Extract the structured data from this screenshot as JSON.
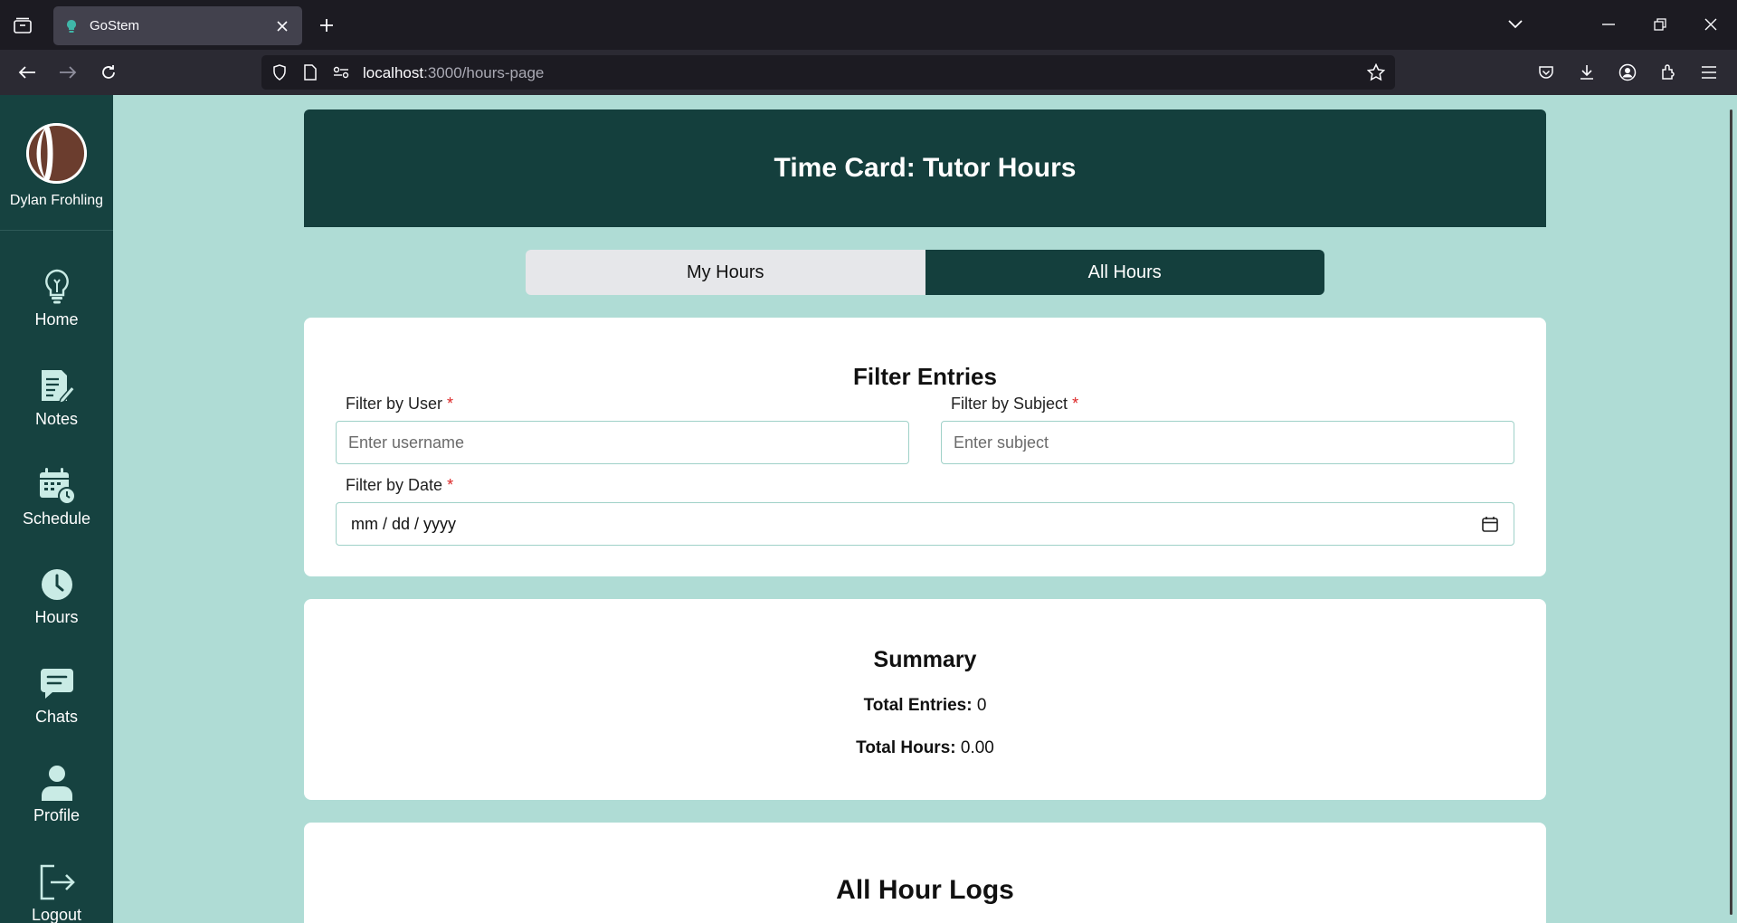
{
  "browser": {
    "tab_title": "GoStem",
    "url_host": "localhost",
    "url_path": ":3000/hours-page"
  },
  "sidebar": {
    "user_name": "Dylan Frohling",
    "items": [
      {
        "label": "Home",
        "icon": "lightbulb-icon"
      },
      {
        "label": "Notes",
        "icon": "notes-icon"
      },
      {
        "label": "Schedule",
        "icon": "calendar-clock-icon"
      },
      {
        "label": "Hours",
        "icon": "clock-icon"
      },
      {
        "label": "Chats",
        "icon": "chat-icon"
      },
      {
        "label": "Profile",
        "icon": "user-icon"
      },
      {
        "label": "Logout",
        "icon": "logout-icon"
      }
    ]
  },
  "page": {
    "title": "Time Card: Tutor Hours",
    "tabs": [
      {
        "label": "My Hours",
        "active": false
      },
      {
        "label": "All Hours",
        "active": true
      }
    ]
  },
  "filters": {
    "heading": "Filter Entries",
    "user_label": "Filter by User",
    "user_placeholder": "Enter username",
    "subject_label": "Filter by Subject",
    "subject_placeholder": "Enter subject",
    "date_label": "Filter by Date",
    "date_placeholder": "mm / dd / yyyy",
    "required_mark": "*"
  },
  "summary": {
    "heading": "Summary",
    "entries_label": "Total Entries:",
    "entries_value": "0",
    "hours_label": "Total Hours:",
    "hours_value": "0.00"
  },
  "logs": {
    "heading": "All Hour Logs"
  },
  "colors": {
    "sidebar": "#164240",
    "header": "#143f3d",
    "background": "#afdcd5",
    "icon": "#c9ebe5"
  }
}
